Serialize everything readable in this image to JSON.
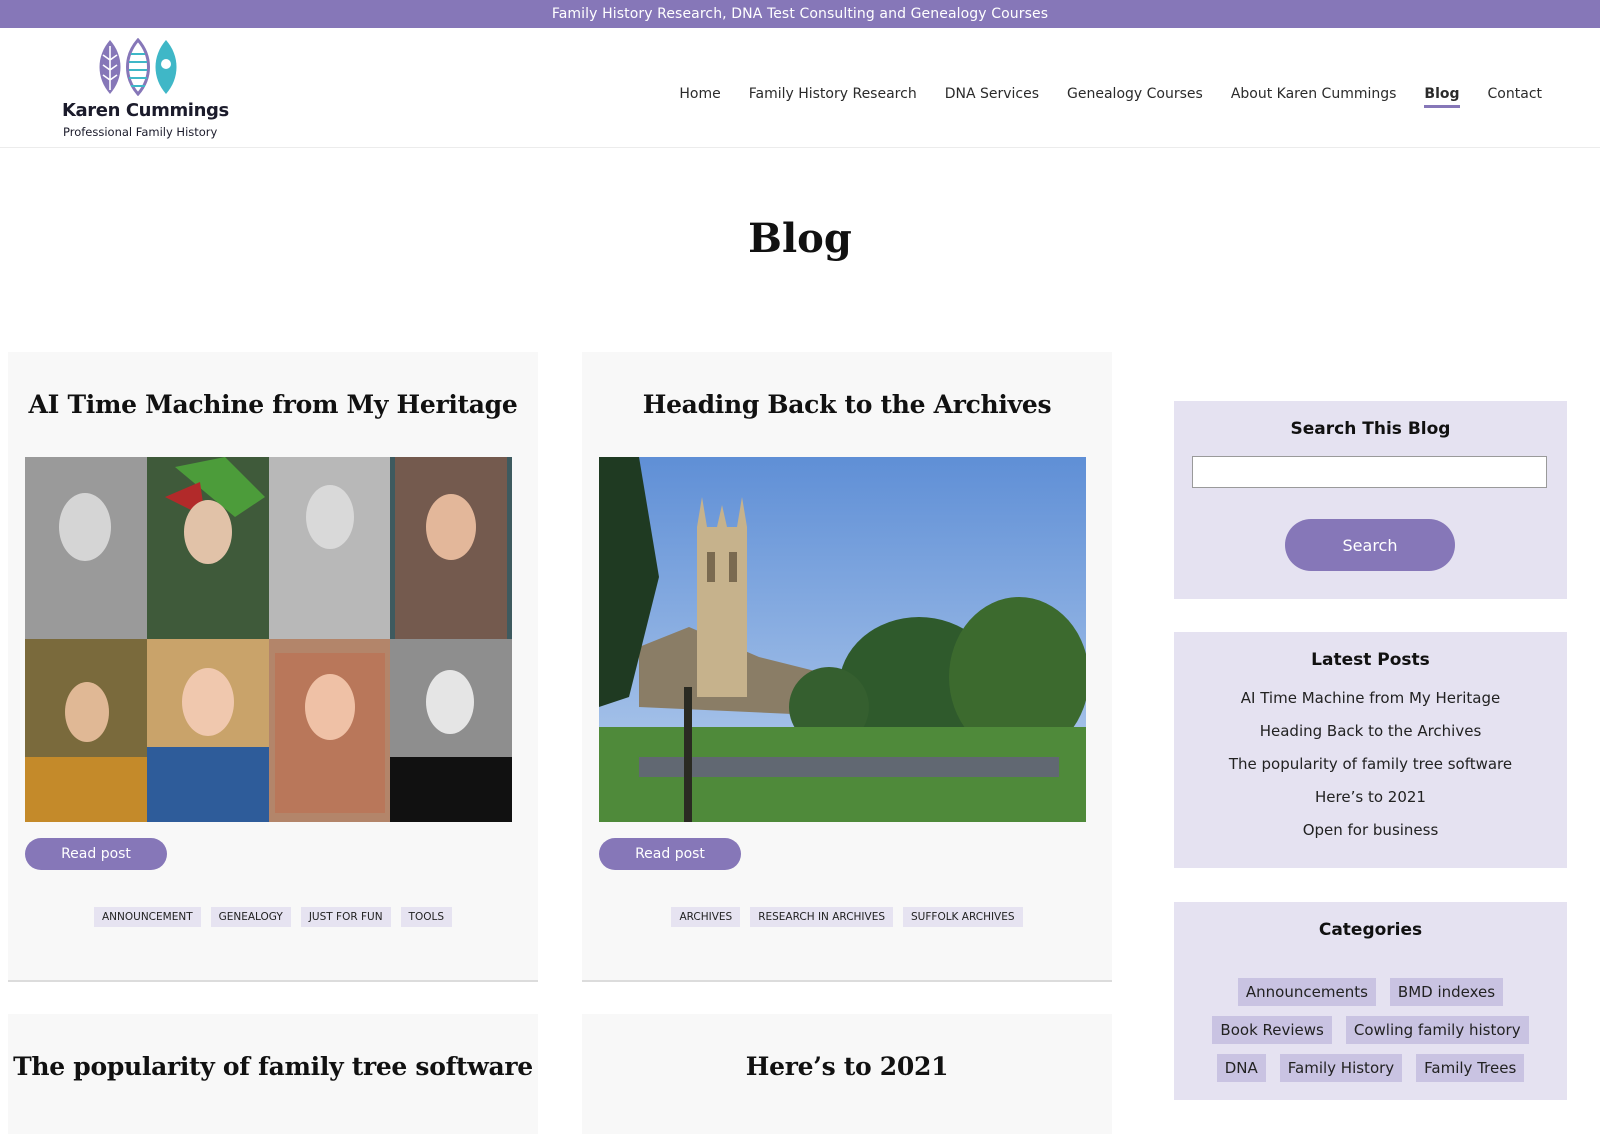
{
  "topbar": {
    "text": "Family History Research, DNA Test Consulting and Genealogy Courses"
  },
  "brand": {
    "name": "Karen Cummings",
    "tagline": "Professional Family History",
    "colors": {
      "accent": "#8677b8",
      "teal": "#3fb7c7",
      "lavender_bg": "#e5e2f1",
      "tag_bg": "#c9c3e2"
    }
  },
  "nav": {
    "items": [
      {
        "label": "Home"
      },
      {
        "label": "Family History Research"
      },
      {
        "label": "DNA Services"
      },
      {
        "label": "Genealogy Courses"
      },
      {
        "label": "About Karen Cummings"
      },
      {
        "label": "Blog",
        "active": true
      },
      {
        "label": "Contact"
      }
    ]
  },
  "page": {
    "title": "Blog"
  },
  "posts": [
    {
      "title": "AI Time Machine from My Heritage",
      "read_label": "Read post",
      "tags": [
        "ANNOUNCEMENT",
        "GENEALOGY",
        "JUST FOR FUN",
        "TOOLS"
      ]
    },
    {
      "title": "Heading Back to the Archives",
      "read_label": "Read post",
      "tags": [
        "ARCHIVES",
        "RESEARCH IN ARCHIVES",
        "SUFFOLK ARCHIVES"
      ]
    },
    {
      "title": "The popularity of family tree software"
    },
    {
      "title": "Here’s to 2021"
    }
  ],
  "sidebar": {
    "search": {
      "title": "Search This Blog",
      "placeholder": "",
      "button_label": "Search"
    },
    "latest": {
      "title": "Latest Posts",
      "items": [
        "AI Time Machine from My Heritage",
        "Heading Back to the Archives",
        "The popularity of family tree software",
        "Here’s to 2021",
        "Open for business"
      ]
    },
    "categories": {
      "title": "Categories",
      "items": [
        "Announcements",
        "BMD indexes",
        "Book Reviews",
        "Cowling family history",
        "DNA",
        "Family History",
        "Family Trees"
      ]
    }
  }
}
